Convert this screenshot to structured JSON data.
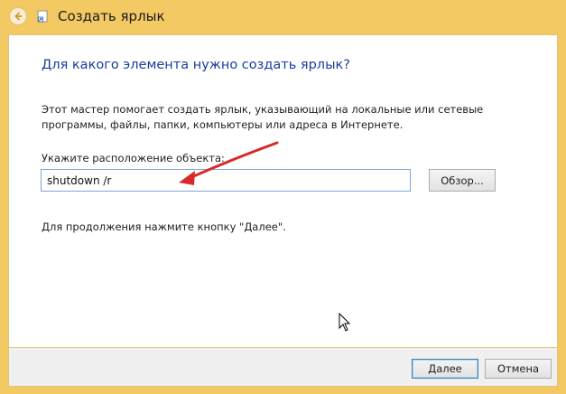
{
  "window": {
    "title": "Создать ярлык"
  },
  "content": {
    "heading": "Для какого элемента нужно создать ярлык?",
    "description": "Этот мастер помогает создать ярлык, указывающий на локальные или сетевые программы, файлы, папки, компьютеры или адреса в Интернете.",
    "field_label": "Укажите расположение объекта:",
    "location_value": "shutdown /r",
    "browse_label": "Обзор...",
    "hint": "Для продолжения нажмите кнопку \"Далее\"."
  },
  "footer": {
    "next_label": "Далее",
    "cancel_label": "Отмена"
  },
  "colors": {
    "heading": "#1a3e9c",
    "frame": "#f3c964",
    "annotation_arrow": "#d8292b"
  },
  "icons": [
    "back-arrow-icon",
    "shortcut-icon",
    "mouse-cursor-icon"
  ]
}
